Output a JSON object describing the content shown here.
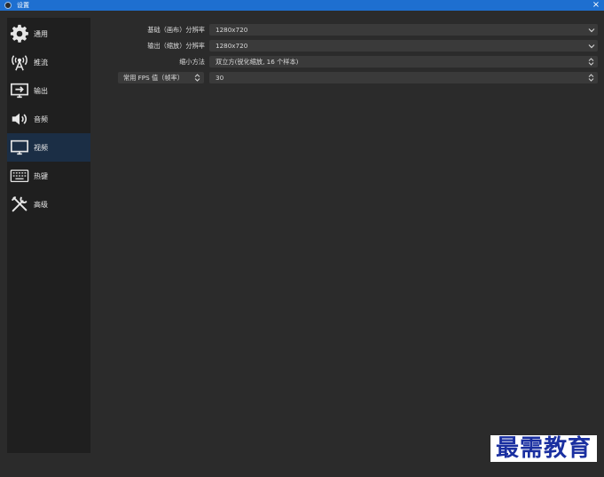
{
  "window": {
    "title": "设置",
    "close_glyph": "×"
  },
  "sidebar": {
    "items": [
      {
        "label": "通用",
        "icon": "gear-icon",
        "active": false
      },
      {
        "label": "推流",
        "icon": "broadcast-icon",
        "active": false
      },
      {
        "label": "输出",
        "icon": "output-icon",
        "active": false
      },
      {
        "label": "音频",
        "icon": "speaker-icon",
        "active": false
      },
      {
        "label": "视频",
        "icon": "monitor-icon",
        "active": true
      },
      {
        "label": "热键",
        "icon": "keyboard-icon",
        "active": false
      },
      {
        "label": "高级",
        "icon": "tools-icon",
        "active": false
      }
    ]
  },
  "video": {
    "base_resolution": {
      "label": "基础（画布）分辨率",
      "value": "1280x720"
    },
    "output_resolution": {
      "label": "输出（缩放）分辨率",
      "value": "1280x720"
    },
    "downscale_filter": {
      "label": "缩小方法",
      "value": "双立方(锐化缩放, 16 个样本)"
    },
    "fps": {
      "label": "常用 FPS 值（帧率）",
      "value": "30"
    }
  },
  "watermark": {
    "text": "最需教育"
  },
  "colors": {
    "titlebar": "#1e6fd0",
    "background": "#2b2b2b",
    "sidebar": "#1f1f1f",
    "active_item": "#1b2e45",
    "field": "#3a3a3a",
    "watermark_text": "#1a2fa0"
  }
}
